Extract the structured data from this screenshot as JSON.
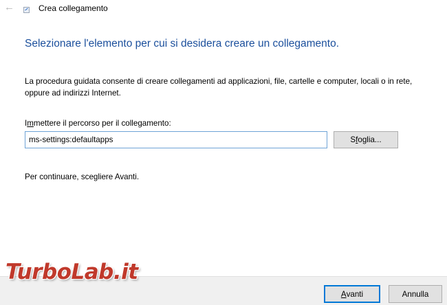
{
  "window": {
    "title": "Crea collegamento",
    "back_icon": "back-arrow-icon",
    "wizard_icon": "shortcut-wizard-icon"
  },
  "main": {
    "heading": "Selezionare l'elemento per cui si desidera creare un collegamento.",
    "description": "La procedura guidata consente di creare collegamenti ad applicazioni, file, cartelle e computer, locali o in rete, oppure ad indirizzi Internet.",
    "path_label_accel": "m",
    "path_label_rest": "mettere il percorso per il collegamento:",
    "path_label_prefix": "I",
    "path_value": "ms-settings:defaultapps",
    "browse_accel": "f",
    "browse_prefix": "S",
    "browse_rest": "oglia...",
    "continue_text": "Per continuare, scegliere Avanti."
  },
  "footer": {
    "next_accel": "A",
    "next_rest": "vanti",
    "cancel_label": "Annulla"
  },
  "watermark": {
    "text": "TurboLab.it"
  },
  "colors": {
    "heading": "#1b4f9c",
    "input_border": "#6ea3d6",
    "default_button_border": "#0078d7",
    "watermark": "#c0392b"
  }
}
